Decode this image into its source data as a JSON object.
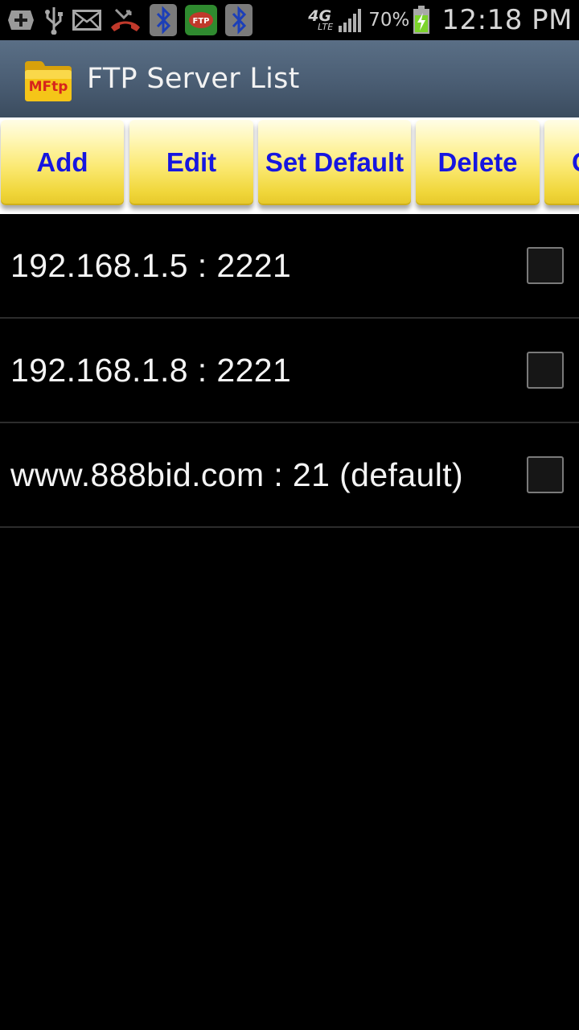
{
  "status_bar": {
    "icons": [
      "add-icon",
      "usb-icon",
      "mail-icon",
      "missed-call-icon",
      "bluetooth-icon",
      "ftp-icon",
      "bluetooth-icon",
      "4g-lte-icon",
      "signal-icon"
    ],
    "ftp_badge": "FTP",
    "network": "4G",
    "network_sub": "LTE",
    "battery_percent": "70%",
    "time": "12:18 PM"
  },
  "app": {
    "logo_text": "MFtp",
    "title": "FTP Server List"
  },
  "toolbar": {
    "buttons": [
      {
        "label": "Add"
      },
      {
        "label": "Edit"
      },
      {
        "label": "Set Default"
      },
      {
        "label": "Delete"
      },
      {
        "label": "C"
      }
    ]
  },
  "servers": [
    {
      "label": "192.168.1.5 : 2221",
      "checked": false
    },
    {
      "label": "192.168.1.8 : 2221",
      "checked": false
    },
    {
      "label": "www.888bid.com : 21 (default)",
      "checked": false
    }
  ],
  "colors": {
    "action_bar": "#4a5d73",
    "button_text": "#1616e0",
    "button_fill": "#fbe972"
  }
}
